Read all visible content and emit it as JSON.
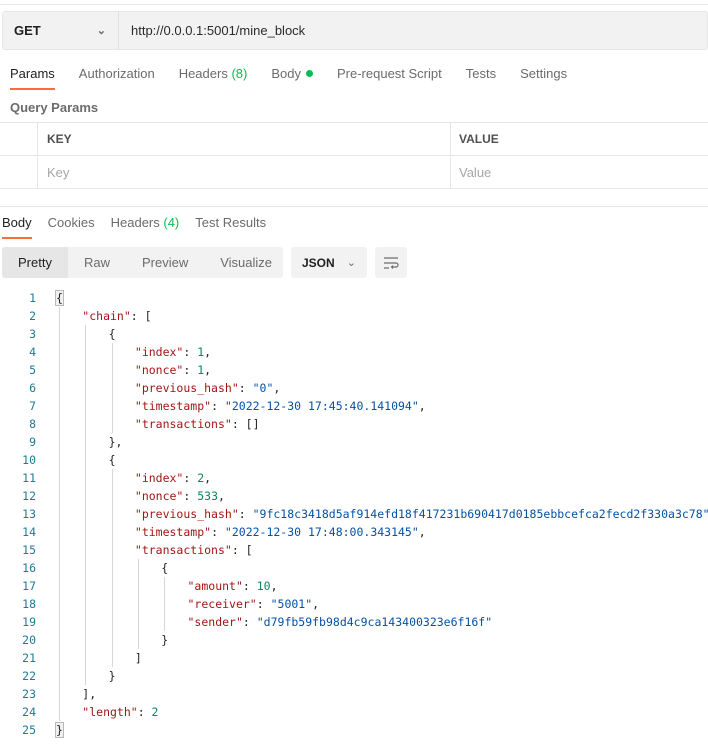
{
  "request": {
    "method": "GET",
    "url": "http://0.0.0.1:5001/mine_block"
  },
  "request_tabs": [
    {
      "label": "Params",
      "active": true
    },
    {
      "label": "Authorization"
    },
    {
      "label": "Headers",
      "count": "(8)"
    },
    {
      "label": "Body",
      "dot": true
    },
    {
      "label": "Pre-request Script"
    },
    {
      "label": "Tests"
    },
    {
      "label": "Settings"
    }
  ],
  "query_params": {
    "title": "Query Params",
    "col_key": "KEY",
    "col_value": "VALUE",
    "key_placeholder": "Key",
    "value_placeholder": "Value"
  },
  "response_tabs": [
    {
      "label": "Body",
      "active": true
    },
    {
      "label": "Cookies"
    },
    {
      "label": "Headers",
      "count": "(4)"
    },
    {
      "label": "Test Results"
    }
  ],
  "view_modes": [
    "Pretty",
    "Raw",
    "Preview",
    "Visualize"
  ],
  "active_view": "Pretty",
  "format": "JSON",
  "icons": {
    "method_dropdown": "chevron-down-icon",
    "format_dropdown": "chevron-down-icon",
    "wrap": "wrap-lines-icon"
  },
  "colors": {
    "accent": "#ff6c37",
    "count": "#0cbb52",
    "key": "#a31515",
    "string": "#0451a5",
    "number": "#098658"
  },
  "code_lines": [
    {
      "i": 0,
      "t": [
        [
          "p",
          "{"
        ]
      ]
    },
    {
      "i": 1,
      "t": [
        [
          "k",
          "\"chain\""
        ],
        [
          "p",
          ": ["
        ]
      ]
    },
    {
      "i": 2,
      "t": [
        [
          "p",
          "{"
        ]
      ]
    },
    {
      "i": 3,
      "t": [
        [
          "k",
          "\"index\""
        ],
        [
          "p",
          ": "
        ],
        [
          "n",
          "1"
        ],
        [
          "p",
          ","
        ]
      ]
    },
    {
      "i": 3,
      "t": [
        [
          "k",
          "\"nonce\""
        ],
        [
          "p",
          ": "
        ],
        [
          "n",
          "1"
        ],
        [
          "p",
          ","
        ]
      ]
    },
    {
      "i": 3,
      "t": [
        [
          "k",
          "\"previous_hash\""
        ],
        [
          "p",
          ": "
        ],
        [
          "s",
          "\"0\""
        ],
        [
          "p",
          ","
        ]
      ]
    },
    {
      "i": 3,
      "t": [
        [
          "k",
          "\"timestamp\""
        ],
        [
          "p",
          ": "
        ],
        [
          "s",
          "\"2022-12-30 17:45:40.141094\""
        ],
        [
          "p",
          ","
        ]
      ]
    },
    {
      "i": 3,
      "t": [
        [
          "k",
          "\"transactions\""
        ],
        [
          "p",
          ": []"
        ]
      ]
    },
    {
      "i": 2,
      "t": [
        [
          "p",
          "},"
        ]
      ]
    },
    {
      "i": 2,
      "t": [
        [
          "p",
          "{"
        ]
      ]
    },
    {
      "i": 3,
      "t": [
        [
          "k",
          "\"index\""
        ],
        [
          "p",
          ": "
        ],
        [
          "n",
          "2"
        ],
        [
          "p",
          ","
        ]
      ]
    },
    {
      "i": 3,
      "t": [
        [
          "k",
          "\"nonce\""
        ],
        [
          "p",
          ": "
        ],
        [
          "n",
          "533"
        ],
        [
          "p",
          ","
        ]
      ]
    },
    {
      "i": 3,
      "t": [
        [
          "k",
          "\"previous_hash\""
        ],
        [
          "p",
          ": "
        ],
        [
          "s",
          "\"9fc18c3418d5af914efd18f417231b690417d0185ebbcefca2fecd2f330a3c78\""
        ],
        [
          "p",
          ","
        ]
      ]
    },
    {
      "i": 3,
      "t": [
        [
          "k",
          "\"timestamp\""
        ],
        [
          "p",
          ": "
        ],
        [
          "s",
          "\"2022-12-30 17:48:00.343145\""
        ],
        [
          "p",
          ","
        ]
      ]
    },
    {
      "i": 3,
      "t": [
        [
          "k",
          "\"transactions\""
        ],
        [
          "p",
          ": ["
        ]
      ]
    },
    {
      "i": 4,
      "t": [
        [
          "p",
          "{"
        ]
      ]
    },
    {
      "i": 5,
      "t": [
        [
          "k",
          "\"amount\""
        ],
        [
          "p",
          ": "
        ],
        [
          "n",
          "10"
        ],
        [
          "p",
          ","
        ]
      ]
    },
    {
      "i": 5,
      "t": [
        [
          "k",
          "\"receiver\""
        ],
        [
          "p",
          ": "
        ],
        [
          "s",
          "\"5001\""
        ],
        [
          "p",
          ","
        ]
      ]
    },
    {
      "i": 5,
      "t": [
        [
          "k",
          "\"sender\""
        ],
        [
          "p",
          ": "
        ],
        [
          "s",
          "\"d79fb59fb98d4c9ca143400323e6f16f\""
        ]
      ]
    },
    {
      "i": 4,
      "t": [
        [
          "p",
          "}"
        ]
      ]
    },
    {
      "i": 3,
      "t": [
        [
          "p",
          "]"
        ]
      ]
    },
    {
      "i": 2,
      "t": [
        [
          "p",
          "}"
        ]
      ]
    },
    {
      "i": 1,
      "t": [
        [
          "p",
          "],"
        ]
      ]
    },
    {
      "i": 1,
      "t": [
        [
          "k",
          "\"length\""
        ],
        [
          "p",
          ": "
        ],
        [
          "n",
          "2"
        ]
      ]
    },
    {
      "i": 0,
      "t": [
        [
          "p",
          "}"
        ]
      ]
    }
  ]
}
